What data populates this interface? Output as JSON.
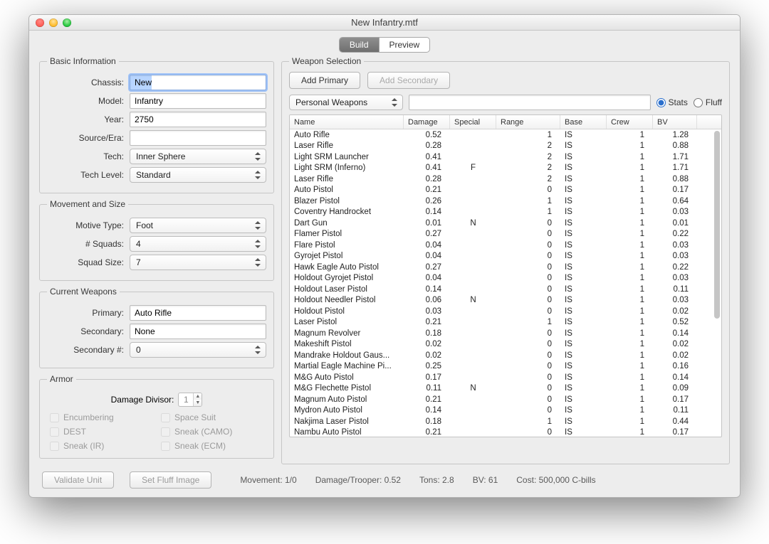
{
  "window": {
    "title": "New Infantry.mtf"
  },
  "tabs": {
    "build": "Build",
    "preview": "Preview"
  },
  "fieldsets": {
    "basic": "Basic Information",
    "movement": "Movement and Size",
    "current": "Current Weapons",
    "armor": "Armor",
    "weapon": "Weapon Selection"
  },
  "labels": {
    "chassis": "Chassis:",
    "model": "Model:",
    "year": "Year:",
    "source": "Source/Era:",
    "tech": "Tech:",
    "techlevel": "Tech Level:",
    "motive": "Motive Type:",
    "squads": "# Squads:",
    "squadsize": "Squad Size:",
    "primary": "Primary:",
    "secondary": "Secondary:",
    "secondaryn": "Secondary #:",
    "divisor": "Damage Divisor:",
    "addprimary": "Add Primary",
    "addsecondary": "Add Secondary",
    "filter": "Personal Weapons",
    "stats": "Stats",
    "fluff": "Fluff"
  },
  "values": {
    "chassis": "New",
    "model": "Infantry",
    "year": "2750",
    "source": "",
    "tech": "Inner Sphere",
    "techlevel": "Standard",
    "motive": "Foot",
    "squads": "4",
    "squadsize": "7",
    "primary": "Auto Rifle",
    "secondary": "None",
    "secondaryn": "0",
    "divisor": "1",
    "search": ""
  },
  "armor_checks": [
    {
      "label": "Encumbering"
    },
    {
      "label": "Space Suit"
    },
    {
      "label": "DEST"
    },
    {
      "label": "Sneak (CAMO)"
    },
    {
      "label": "Sneak (IR)"
    },
    {
      "label": "Sneak (ECM)"
    }
  ],
  "columns": [
    "Name",
    "Damage",
    "Special",
    "Range",
    "Base",
    "Crew",
    "BV"
  ],
  "weapons": [
    {
      "name": "Auto Rifle",
      "dmg": "0.52",
      "sp": "",
      "rng": "1",
      "base": "IS",
      "crew": "1",
      "bv": "1.28"
    },
    {
      "name": "Laser Rifle",
      "dmg": "0.28",
      "sp": "",
      "rng": "2",
      "base": "IS",
      "crew": "1",
      "bv": "0.88"
    },
    {
      "name": "Light SRM Launcher",
      "dmg": "0.41",
      "sp": "",
      "rng": "2",
      "base": "IS",
      "crew": "1",
      "bv": "1.71"
    },
    {
      "name": "Light SRM (Inferno)",
      "dmg": "0.41",
      "sp": "F",
      "rng": "2",
      "base": "IS",
      "crew": "1",
      "bv": "1.71"
    },
    {
      "name": "Laser Rifle",
      "dmg": "0.28",
      "sp": "",
      "rng": "2",
      "base": "IS",
      "crew": "1",
      "bv": "0.88"
    },
    {
      "name": "Auto Pistol",
      "dmg": "0.21",
      "sp": "",
      "rng": "0",
      "base": "IS",
      "crew": "1",
      "bv": "0.17"
    },
    {
      "name": "Blazer Pistol",
      "dmg": "0.26",
      "sp": "",
      "rng": "1",
      "base": "IS",
      "crew": "1",
      "bv": "0.64"
    },
    {
      "name": "Coventry Handrocket",
      "dmg": "0.14",
      "sp": "",
      "rng": "1",
      "base": "IS",
      "crew": "1",
      "bv": "0.03"
    },
    {
      "name": "Dart Gun",
      "dmg": "0.01",
      "sp": "N",
      "rng": "0",
      "base": "IS",
      "crew": "1",
      "bv": "0.01"
    },
    {
      "name": "Flamer Pistol",
      "dmg": "0.27",
      "sp": "",
      "rng": "0",
      "base": "IS",
      "crew": "1",
      "bv": "0.22"
    },
    {
      "name": "Flare Pistol",
      "dmg": "0.04",
      "sp": "",
      "rng": "0",
      "base": "IS",
      "crew": "1",
      "bv": "0.03"
    },
    {
      "name": "Gyrojet Pistol",
      "dmg": "0.04",
      "sp": "",
      "rng": "0",
      "base": "IS",
      "crew": "1",
      "bv": "0.03"
    },
    {
      "name": "Hawk Eagle Auto Pistol",
      "dmg": "0.27",
      "sp": "",
      "rng": "0",
      "base": "IS",
      "crew": "1",
      "bv": "0.22"
    },
    {
      "name": "Holdout Gyrojet Pistol",
      "dmg": "0.04",
      "sp": "",
      "rng": "0",
      "base": "IS",
      "crew": "1",
      "bv": "0.03"
    },
    {
      "name": "Holdout Laser Pistol",
      "dmg": "0.14",
      "sp": "",
      "rng": "0",
      "base": "IS",
      "crew": "1",
      "bv": "0.11"
    },
    {
      "name": "Holdout Needler Pistol",
      "dmg": "0.06",
      "sp": "N",
      "rng": "0",
      "base": "IS",
      "crew": "1",
      "bv": "0.03"
    },
    {
      "name": "Holdout Pistol",
      "dmg": "0.03",
      "sp": "",
      "rng": "0",
      "base": "IS",
      "crew": "1",
      "bv": "0.02"
    },
    {
      "name": "Laser Pistol",
      "dmg": "0.21",
      "sp": "",
      "rng": "1",
      "base": "IS",
      "crew": "1",
      "bv": "0.52"
    },
    {
      "name": "Magnum Revolver",
      "dmg": "0.18",
      "sp": "",
      "rng": "0",
      "base": "IS",
      "crew": "1",
      "bv": "0.14"
    },
    {
      "name": "Makeshift Pistol",
      "dmg": "0.02",
      "sp": "",
      "rng": "0",
      "base": "IS",
      "crew": "1",
      "bv": "0.02"
    },
    {
      "name": "Mandrake Holdout Gaus...",
      "dmg": "0.02",
      "sp": "",
      "rng": "0",
      "base": "IS",
      "crew": "1",
      "bv": "0.02"
    },
    {
      "name": "Martial Eagle Machine Pi...",
      "dmg": "0.25",
      "sp": "",
      "rng": "0",
      "base": "IS",
      "crew": "1",
      "bv": "0.16"
    },
    {
      "name": "M&G Auto Pistol",
      "dmg": "0.17",
      "sp": "",
      "rng": "0",
      "base": "IS",
      "crew": "1",
      "bv": "0.14"
    },
    {
      "name": "M&G Flechette Pistol",
      "dmg": "0.11",
      "sp": "N",
      "rng": "0",
      "base": "IS",
      "crew": "1",
      "bv": "0.09"
    },
    {
      "name": "Magnum Auto Pistol",
      "dmg": "0.21",
      "sp": "",
      "rng": "0",
      "base": "IS",
      "crew": "1",
      "bv": "0.17"
    },
    {
      "name": "Mydron Auto Pistol",
      "dmg": "0.14",
      "sp": "",
      "rng": "0",
      "base": "IS",
      "crew": "1",
      "bv": "0.11"
    },
    {
      "name": "Nakjima Laser Pistol",
      "dmg": "0.18",
      "sp": "",
      "rng": "1",
      "base": "IS",
      "crew": "1",
      "bv": "0.44"
    },
    {
      "name": "Nambu Auto Pistol",
      "dmg": "0.21",
      "sp": "",
      "rng": "0",
      "base": "IS",
      "crew": "1",
      "bv": "0.17"
    }
  ],
  "footer": {
    "validate": "Validate Unit",
    "fluffimg": "Set Fluff Image",
    "movement": "Movement: 1/0",
    "dmg": "Damage/Trooper: 0.52",
    "tons": "Tons: 2.8",
    "bv": "BV: 61",
    "cost": "Cost: 500,000 C-bills"
  }
}
